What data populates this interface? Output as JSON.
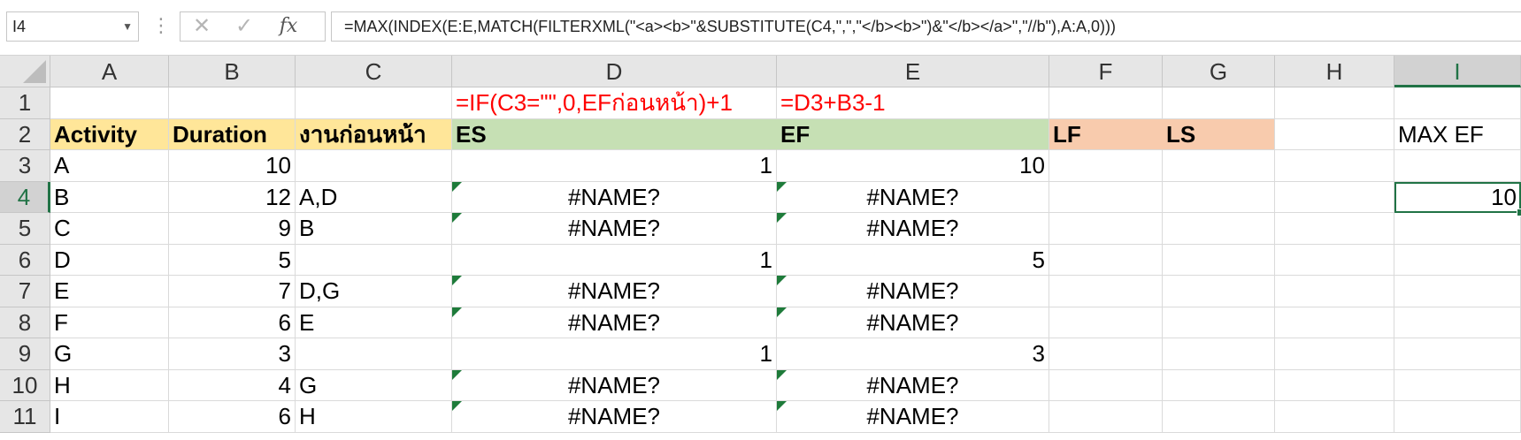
{
  "formula_bar": {
    "name_box": "I4",
    "cancel_icon": "✕",
    "enter_icon": "✓",
    "fx_label": "fx",
    "formula": "=MAX(INDEX(E:E,MATCH(FILTERXML(\"<a><b>\"&SUBSTITUTE(C4,\",\",\"</b><b>\")&\"</b></a>\",\"//b\"),A:A,0)))"
  },
  "columns": [
    "A",
    "B",
    "C",
    "D",
    "E",
    "F",
    "G",
    "H",
    "I"
  ],
  "selected_column": "I",
  "rows": [
    "1",
    "2",
    "3",
    "4",
    "5",
    "6",
    "7",
    "8",
    "9",
    "10",
    "11"
  ],
  "selected_row": "4",
  "row1": {
    "d_note": "=IF(C3=\"\",0,EFก่อนหน้า)+1",
    "e_note": "=D3+B3-1"
  },
  "headers": {
    "activity": "Activity",
    "duration": "Duration",
    "predecessor": "งานก่อนหน้า",
    "es": "ES",
    "ef": "EF",
    "lf": "LF",
    "ls": "LS",
    "max_ef": "MAX EF"
  },
  "table": [
    {
      "activity": "A",
      "duration": "10",
      "pred": "",
      "es": "1",
      "ef": "10",
      "err": false
    },
    {
      "activity": "B",
      "duration": "12",
      "pred": "A,D",
      "es": "#NAME?",
      "ef": "#NAME?",
      "err": true
    },
    {
      "activity": "C",
      "duration": "9",
      "pred": "B",
      "es": "#NAME?",
      "ef": "#NAME?",
      "err": true
    },
    {
      "activity": "D",
      "duration": "5",
      "pred": "",
      "es": "1",
      "ef": "5",
      "err": false
    },
    {
      "activity": "E",
      "duration": "7",
      "pred": "D,G",
      "es": "#NAME?",
      "ef": "#NAME?",
      "err": true
    },
    {
      "activity": "F",
      "duration": "6",
      "pred": "E",
      "es": "#NAME?",
      "ef": "#NAME?",
      "err": true
    },
    {
      "activity": "G",
      "duration": "3",
      "pred": "",
      "es": "1",
      "ef": "3",
      "err": false
    },
    {
      "activity": "H",
      "duration": "4",
      "pred": "G",
      "es": "#NAME?",
      "ef": "#NAME?",
      "err": true
    },
    {
      "activity": "I",
      "duration": "6",
      "pred": "H",
      "es": "#NAME?",
      "ef": "#NAME?",
      "err": true
    }
  ],
  "max_ef_value": "10",
  "colors": {
    "header_yellow": "#ffe699",
    "header_green": "#c6e0b4",
    "header_orange": "#f8cbad",
    "note_red": "#ff0000",
    "excel_green": "#217346"
  }
}
